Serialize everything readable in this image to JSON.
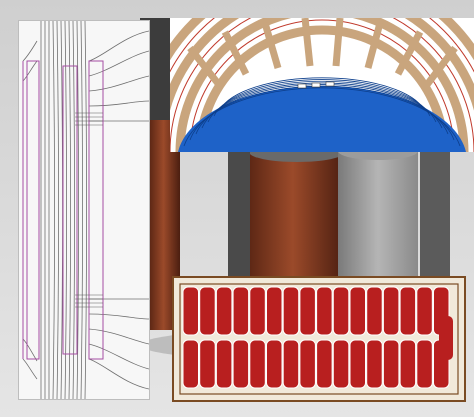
{
  "colors": {
    "winding_copper": "#8a3f23",
    "core_gray": "#a9a9a9",
    "field_lines": "#707070",
    "winding_outline": "#a64da3",
    "insulation_wood": "#c9a57d",
    "strand_blue": "#1e62c8",
    "conductor_red": "#b81f1f",
    "frame_brown": "#7a4b23"
  }
}
